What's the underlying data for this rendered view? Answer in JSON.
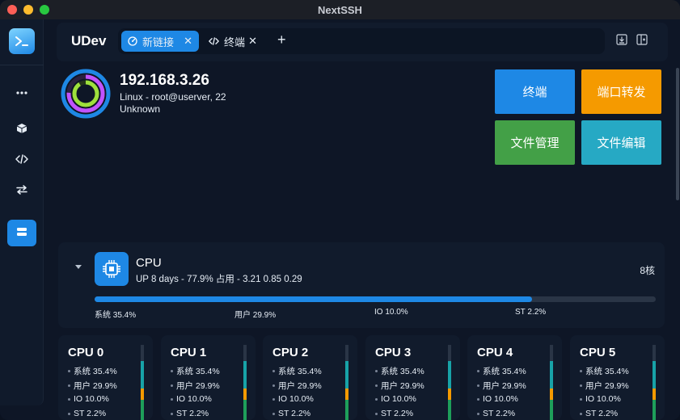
{
  "window": {
    "title": "NextSSH"
  },
  "sidebar": {
    "logo_icon": "terminal-prompt-icon",
    "items": [
      {
        "name": "more",
        "icon": "ellipsis-icon",
        "active": false
      },
      {
        "name": "cube",
        "icon": "cube-icon",
        "active": false
      },
      {
        "name": "code",
        "icon": "code-icon",
        "active": false
      },
      {
        "name": "transfer",
        "icon": "swap-arrows-icon",
        "active": false
      },
      {
        "name": "server",
        "icon": "server-icon",
        "active": true
      }
    ]
  },
  "header": {
    "app_name": "UDev",
    "tabs": [
      {
        "label": "新链接",
        "icon": "gauge-icon",
        "active": true,
        "close": "✕"
      },
      {
        "label": "终端",
        "icon": "code-icon",
        "active": false,
        "close": "✕"
      }
    ],
    "add_tab": "+"
  },
  "host": {
    "ip": "192.168.3.26",
    "os_line": "Linux - root@userver, 22",
    "status": "Unknown"
  },
  "actions": [
    {
      "label": "终端",
      "color": "#1e88e5"
    },
    {
      "label": "端口转发",
      "color": "#f59a00"
    },
    {
      "label": "文件管理",
      "color": "#43a047"
    },
    {
      "label": "文件编辑",
      "color": "#26a9c4"
    }
  ],
  "cpu": {
    "title": "CPU",
    "subtitle": "UP 8 days - 77.9% 占用 - 3.21 0.85 0.29",
    "cores_label": "8核",
    "usage_fraction": 0.779,
    "stats": [
      {
        "label": "系统 35.4%"
      },
      {
        "label": "用户 29.9%"
      },
      {
        "label": "IO 10.0%"
      },
      {
        "label": "ST 2.2%"
      }
    ]
  },
  "cores": [
    {
      "name": "CPU 0",
      "sys": "系统 35.4%",
      "user": "用户 29.9%",
      "io": "IO 10.0%",
      "st": "ST 2.2%"
    },
    {
      "name": "CPU 1",
      "sys": "系统 35.4%",
      "user": "用户 29.9%",
      "io": "IO 10.0%",
      "st": "ST 2.2%"
    },
    {
      "name": "CPU 2",
      "sys": "系统 35.4%",
      "user": "用户 29.9%",
      "io": "IO 10.0%",
      "st": "ST 2.2%"
    },
    {
      "name": "CPU 3",
      "sys": "系统 35.4%",
      "user": "用户 29.9%",
      "io": "IO 10.0%",
      "st": "ST 2.2%"
    },
    {
      "name": "CPU 4",
      "sys": "系统 35.4%",
      "user": "用户 29.9%",
      "io": "IO 10.0%",
      "st": "ST 2.2%"
    },
    {
      "name": "CPU 5",
      "sys": "系统 35.4%",
      "user": "用户 29.9%",
      "io": "IO 10.0%",
      "st": "ST 2.2%"
    }
  ],
  "colors": {
    "accent": "#1e88e5",
    "ring_outer": "#c153ff",
    "ring_inner": "#9ee03c",
    "core_bar_sys": "#18a3a8",
    "core_bar_user": "#f59a00",
    "core_bar_io": "#1e9f5a"
  }
}
